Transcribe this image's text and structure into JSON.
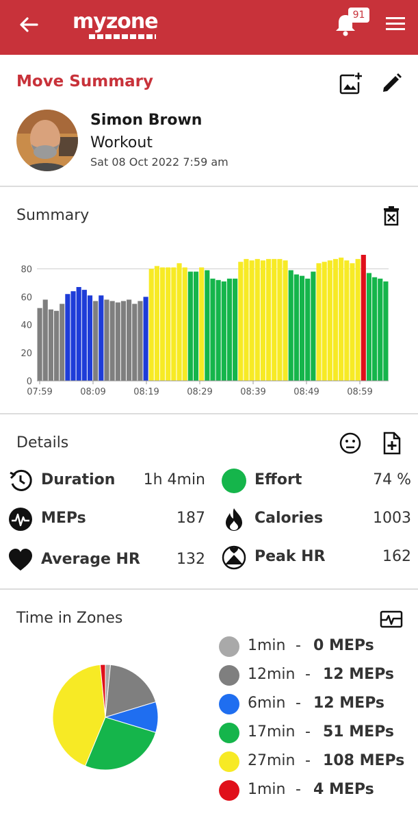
{
  "header": {
    "logo_text": "myzone",
    "notifications_count": "91"
  },
  "move": {
    "title": "Move Summary",
    "user_name": "Simon Brown",
    "workout_type": "Workout",
    "date": "Sat 08 Oct 2022 7:59 am"
  },
  "summary": {
    "title": "Summary"
  },
  "chart_data": {
    "type": "bar",
    "y_ticks": [
      "0",
      "20",
      "40",
      "60",
      "80"
    ],
    "x_ticks": [
      "07:59",
      "08:09",
      "08:19",
      "08:29",
      "08:39",
      "08:49",
      "08:59"
    ],
    "ylim": [
      0,
      90
    ],
    "zone_colors": {
      "gray": "#7f7f7f",
      "blue": "#1e3cd8",
      "yellow": "#f7ea25",
      "green": "#15b54b",
      "red": "#e0101a"
    },
    "values": [
      52,
      58,
      51,
      50,
      55,
      62,
      64,
      67,
      65,
      61,
      57,
      61,
      58,
      57,
      56,
      57,
      58,
      55,
      57,
      60,
      80,
      82,
      81,
      81,
      81,
      84,
      81,
      78,
      78,
      81,
      79,
      73,
      72,
      71,
      73,
      73,
      85,
      87,
      86,
      87,
      86,
      87,
      87,
      87,
      86,
      79,
      76,
      75,
      73,
      78,
      84,
      85,
      86,
      87,
      88,
      86,
      84,
      87,
      90,
      77,
      74,
      73,
      71
    ],
    "zones": [
      "gray",
      "gray",
      "gray",
      "gray",
      "gray",
      "blue",
      "blue",
      "blue",
      "blue",
      "blue",
      "gray",
      "blue",
      "gray",
      "gray",
      "gray",
      "gray",
      "gray",
      "gray",
      "gray",
      "blue",
      "yellow",
      "yellow",
      "yellow",
      "yellow",
      "yellow",
      "yellow",
      "yellow",
      "green",
      "green",
      "yellow",
      "green",
      "green",
      "green",
      "green",
      "green",
      "green",
      "yellow",
      "yellow",
      "yellow",
      "yellow",
      "yellow",
      "yellow",
      "yellow",
      "yellow",
      "yellow",
      "green",
      "green",
      "green",
      "green",
      "green",
      "yellow",
      "yellow",
      "yellow",
      "yellow",
      "yellow",
      "yellow",
      "yellow",
      "yellow",
      "red",
      "green",
      "green",
      "green",
      "green"
    ]
  },
  "details": {
    "title": "Details",
    "items": [
      {
        "label": "Duration",
        "value": "1h 4min",
        "icon": "duration-icon"
      },
      {
        "label": "MEPs",
        "value": "187",
        "icon": "meps-icon"
      },
      {
        "label": "Average HR",
        "value": "132",
        "icon": "heart-icon"
      },
      {
        "label": "Effort",
        "value": "74 %",
        "icon": "effort-icon"
      },
      {
        "label": "Calories",
        "value": "1003",
        "icon": "flame-icon"
      },
      {
        "label": "Peak HR",
        "value": "162",
        "icon": "peak-hr-icon"
      }
    ],
    "effort_color": "#15b54b"
  },
  "zones": {
    "title": "Time in Zones",
    "items": [
      {
        "time": "1min",
        "meps": "0 MEPs",
        "color": "#a9a9a9",
        "minutes": 1
      },
      {
        "time": "12min",
        "meps": "12 MEPs",
        "color": "#7f7f7f",
        "minutes": 12
      },
      {
        "time": "6min",
        "meps": "12 MEPs",
        "color": "#1f6ef0",
        "minutes": 6
      },
      {
        "time": "17min",
        "meps": "51 MEPs",
        "color": "#15b54b",
        "minutes": 17
      },
      {
        "time": "27min",
        "meps": "108 MEPs",
        "color": "#f7ea25",
        "minutes": 27
      },
      {
        "time": "1min",
        "meps": "4 MEPs",
        "color": "#e0101a",
        "minutes": 1
      }
    ],
    "separator": "-"
  }
}
